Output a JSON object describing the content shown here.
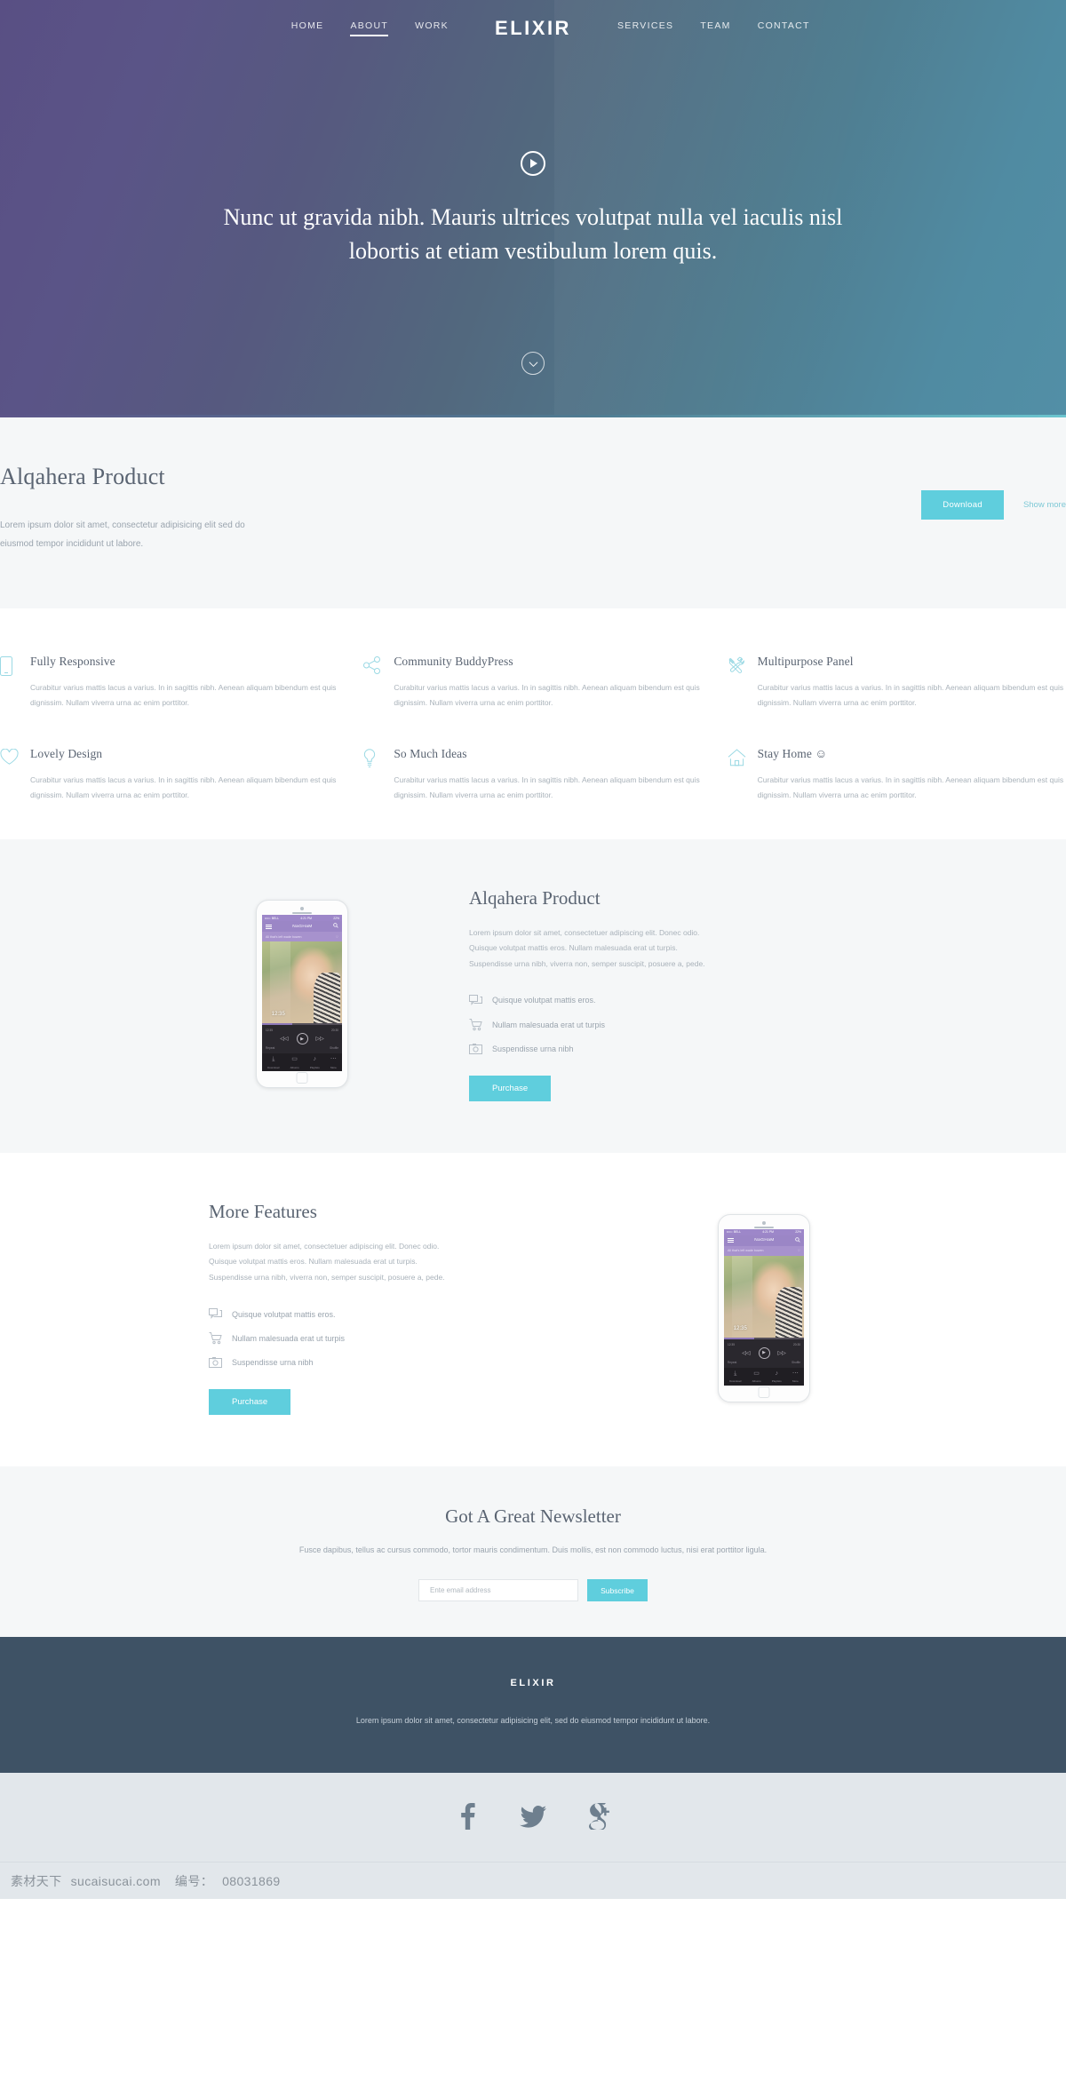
{
  "theme": {
    "accent": "#5fcedd",
    "hero_gradient_start": "#594f84",
    "hero_gradient_end": "#508ba2",
    "footer_bg": "#3e5265",
    "text_dark": "#5a6472",
    "text_muted": "#a9b2ba"
  },
  "header": {
    "brand": "ELIXIR",
    "nav_left": [
      {
        "label": "HOME",
        "active": false
      },
      {
        "label": "ABOUT",
        "active": true
      },
      {
        "label": "WORK",
        "active": false
      }
    ],
    "nav_right": [
      {
        "label": "SERVICES",
        "active": false
      },
      {
        "label": "TEAM",
        "active": false
      },
      {
        "label": "CONTACT",
        "active": false
      }
    ]
  },
  "hero": {
    "play_icon": "play-icon",
    "headline": "Nunc ut gravida nibh. Mauris ultrices volutpat nulla vel iaculis nisl lobortis at etiam vestibulum lorem quis.",
    "scroll_icon": "chevron-down-icon"
  },
  "intro": {
    "title": "Alqahera Product",
    "paragraph": "Lorem ipsum dolor sit amet, consectetur adipisicing elit sed do eiusmod tempor incididunt ut labore.",
    "download_label": "Download",
    "show_more_label": "Show more"
  },
  "features": [
    {
      "icon": "mobile-icon",
      "title": "Fully Responsive",
      "text": "Curabitur varius mattis lacus a varius. In in sagittis nibh. Aenean aliquam bibendum est quis dignissim. Nullam viverra urna ac enim porttitor."
    },
    {
      "icon": "share-nodes-icon",
      "title": "Community BuddyPress",
      "text": "Curabitur varius mattis lacus a varius. In in sagittis nibh. Aenean aliquam bibendum est quis dignissim. Nullam viverra urna ac enim porttitor."
    },
    {
      "icon": "tools-icon",
      "title": "Multipurpose Panel",
      "text": "Curabitur varius mattis lacus a varius. In in sagittis nibh. Aenean aliquam bibendum est quis dignissim. Nullam viverra urna ac enim porttitor."
    },
    {
      "icon": "heart-icon",
      "title": "Lovely Design",
      "text": "Curabitur varius mattis lacus a varius. In in sagittis nibh. Aenean aliquam bibendum est quis dignissim. Nullam viverra urna ac enim porttitor."
    },
    {
      "icon": "lightbulb-icon",
      "title": "So Much Ideas",
      "text": "Curabitur varius mattis lacus a varius. In in sagittis nibh. Aenean aliquam bibendum est quis dignissim. Nullam viverra urna ac enim porttitor."
    },
    {
      "icon": "home-icon",
      "title": "Stay Home ☺",
      "text": "Curabitur varius mattis lacus a varius. In in sagittis nibh. Aenean aliquam bibendum est quis dignissim. Nullam viverra urna ac enim porttitor."
    }
  ],
  "product": {
    "title": "Alqahera Product",
    "paragraph": "Lorem ipsum dolor sit amet, consectetuer adipiscing elit. Donec odio. Quisque volutpat mattis eros. Nullam malesuada erat ut turpis. Suspendisse urna nibh, viverra non, semper suscipit, posuere a, pede.",
    "bullets": [
      {
        "icon": "chat-icon",
        "text": "Quisque volutpat mattis eros."
      },
      {
        "icon": "cart-icon",
        "text": "Nullam malesuada erat ut turpis"
      },
      {
        "icon": "camera-icon",
        "text": "Suspendisse urna nibh"
      }
    ],
    "purchase_label": "Purchase"
  },
  "more_features": {
    "title": "More Features",
    "paragraph": "Lorem ipsum dolor sit amet, consectetuer adipiscing elit. Donec odio. Quisque volutpat mattis eros. Nullam malesuada erat ut turpis. Suspendisse urna nibh, viverra non, semper suscipit, posuere a, pede.",
    "bullets": [
      {
        "icon": "chat-icon",
        "text": "Quisque volutpat mattis eros."
      },
      {
        "icon": "cart-icon",
        "text": "Nullam malesuada erat ut turpis"
      },
      {
        "icon": "camera-icon",
        "text": "Suspendisse urna nibh"
      }
    ],
    "purchase_label": "Purchase"
  },
  "phone_mockup": {
    "carrier": "••••○ BELL",
    "wifi_icon": "wifi-icon",
    "time": "4:21 PM",
    "battery": "22%",
    "app_title": "NaGHaM",
    "search_icon": "search-icon",
    "menu_icon": "hamburger-icon",
    "now_playing": "All that's left wade bowen",
    "heart_icon": "heart-outline-icon",
    "overlay_time": "12:35",
    "elapsed": "12:35",
    "duration": "20:30",
    "repeat_label": "Repeat",
    "shuffle_label": "Shuffle",
    "tabs": [
      {
        "icon": "download-icon",
        "label": "Download"
      },
      {
        "icon": "albums-icon",
        "label": "Albums"
      },
      {
        "icon": "playlists-icon",
        "label": "Playlists"
      },
      {
        "icon": "more-icon",
        "label": "More"
      }
    ]
  },
  "newsletter": {
    "title": "Got A Great Newsletter",
    "paragraph": "Fusce dapibus, tellus ac cursus commodo, tortor mauris condimentum. Duis mollis, est non commodo luctus, nisi erat porttitor ligula.",
    "input_placeholder": "Ente email address",
    "input_value": "",
    "subscribe_label": "Subscribe"
  },
  "footer": {
    "brand": "ELIXIR",
    "text": "Lorem ipsum dolor sit amet, consectetur adipisicing elit, sed do eiusmod tempor incididunt ut labore.",
    "social": [
      {
        "icon": "facebook-icon",
        "label": "f"
      },
      {
        "icon": "twitter-icon",
        "label": "t"
      },
      {
        "icon": "google-plus-icon",
        "label": "g"
      }
    ]
  },
  "watermark": {
    "site_cn": "素材天下",
    "site": "sucaisucai.com",
    "id_label": "编号：",
    "id_value": "08031869"
  }
}
